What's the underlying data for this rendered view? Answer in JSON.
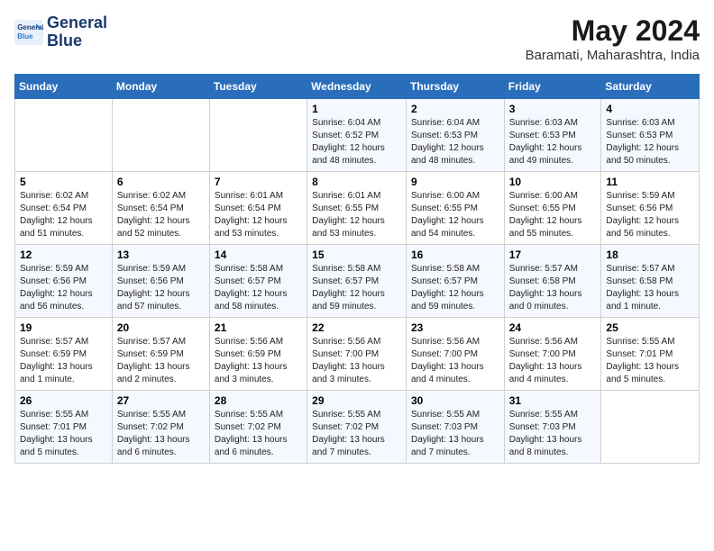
{
  "header": {
    "logo_line1": "General",
    "logo_line2": "Blue",
    "month_title": "May 2024",
    "location": "Baramati, Maharashtra, India"
  },
  "weekdays": [
    "Sunday",
    "Monday",
    "Tuesday",
    "Wednesday",
    "Thursday",
    "Friday",
    "Saturday"
  ],
  "weeks": [
    [
      {
        "day": "",
        "info": ""
      },
      {
        "day": "",
        "info": ""
      },
      {
        "day": "",
        "info": ""
      },
      {
        "day": "1",
        "info": "Sunrise: 6:04 AM\nSunset: 6:52 PM\nDaylight: 12 hours\nand 48 minutes."
      },
      {
        "day": "2",
        "info": "Sunrise: 6:04 AM\nSunset: 6:53 PM\nDaylight: 12 hours\nand 48 minutes."
      },
      {
        "day": "3",
        "info": "Sunrise: 6:03 AM\nSunset: 6:53 PM\nDaylight: 12 hours\nand 49 minutes."
      },
      {
        "day": "4",
        "info": "Sunrise: 6:03 AM\nSunset: 6:53 PM\nDaylight: 12 hours\nand 50 minutes."
      }
    ],
    [
      {
        "day": "5",
        "info": "Sunrise: 6:02 AM\nSunset: 6:54 PM\nDaylight: 12 hours\nand 51 minutes."
      },
      {
        "day": "6",
        "info": "Sunrise: 6:02 AM\nSunset: 6:54 PM\nDaylight: 12 hours\nand 52 minutes."
      },
      {
        "day": "7",
        "info": "Sunrise: 6:01 AM\nSunset: 6:54 PM\nDaylight: 12 hours\nand 53 minutes."
      },
      {
        "day": "8",
        "info": "Sunrise: 6:01 AM\nSunset: 6:55 PM\nDaylight: 12 hours\nand 53 minutes."
      },
      {
        "day": "9",
        "info": "Sunrise: 6:00 AM\nSunset: 6:55 PM\nDaylight: 12 hours\nand 54 minutes."
      },
      {
        "day": "10",
        "info": "Sunrise: 6:00 AM\nSunset: 6:55 PM\nDaylight: 12 hours\nand 55 minutes."
      },
      {
        "day": "11",
        "info": "Sunrise: 5:59 AM\nSunset: 6:56 PM\nDaylight: 12 hours\nand 56 minutes."
      }
    ],
    [
      {
        "day": "12",
        "info": "Sunrise: 5:59 AM\nSunset: 6:56 PM\nDaylight: 12 hours\nand 56 minutes."
      },
      {
        "day": "13",
        "info": "Sunrise: 5:59 AM\nSunset: 6:56 PM\nDaylight: 12 hours\nand 57 minutes."
      },
      {
        "day": "14",
        "info": "Sunrise: 5:58 AM\nSunset: 6:57 PM\nDaylight: 12 hours\nand 58 minutes."
      },
      {
        "day": "15",
        "info": "Sunrise: 5:58 AM\nSunset: 6:57 PM\nDaylight: 12 hours\nand 59 minutes."
      },
      {
        "day": "16",
        "info": "Sunrise: 5:58 AM\nSunset: 6:57 PM\nDaylight: 12 hours\nand 59 minutes."
      },
      {
        "day": "17",
        "info": "Sunrise: 5:57 AM\nSunset: 6:58 PM\nDaylight: 13 hours\nand 0 minutes."
      },
      {
        "day": "18",
        "info": "Sunrise: 5:57 AM\nSunset: 6:58 PM\nDaylight: 13 hours\nand 1 minute."
      }
    ],
    [
      {
        "day": "19",
        "info": "Sunrise: 5:57 AM\nSunset: 6:59 PM\nDaylight: 13 hours\nand 1 minute."
      },
      {
        "day": "20",
        "info": "Sunrise: 5:57 AM\nSunset: 6:59 PM\nDaylight: 13 hours\nand 2 minutes."
      },
      {
        "day": "21",
        "info": "Sunrise: 5:56 AM\nSunset: 6:59 PM\nDaylight: 13 hours\nand 3 minutes."
      },
      {
        "day": "22",
        "info": "Sunrise: 5:56 AM\nSunset: 7:00 PM\nDaylight: 13 hours\nand 3 minutes."
      },
      {
        "day": "23",
        "info": "Sunrise: 5:56 AM\nSunset: 7:00 PM\nDaylight: 13 hours\nand 4 minutes."
      },
      {
        "day": "24",
        "info": "Sunrise: 5:56 AM\nSunset: 7:00 PM\nDaylight: 13 hours\nand 4 minutes."
      },
      {
        "day": "25",
        "info": "Sunrise: 5:55 AM\nSunset: 7:01 PM\nDaylight: 13 hours\nand 5 minutes."
      }
    ],
    [
      {
        "day": "26",
        "info": "Sunrise: 5:55 AM\nSunset: 7:01 PM\nDaylight: 13 hours\nand 5 minutes."
      },
      {
        "day": "27",
        "info": "Sunrise: 5:55 AM\nSunset: 7:02 PM\nDaylight: 13 hours\nand 6 minutes."
      },
      {
        "day": "28",
        "info": "Sunrise: 5:55 AM\nSunset: 7:02 PM\nDaylight: 13 hours\nand 6 minutes."
      },
      {
        "day": "29",
        "info": "Sunrise: 5:55 AM\nSunset: 7:02 PM\nDaylight: 13 hours\nand 7 minutes."
      },
      {
        "day": "30",
        "info": "Sunrise: 5:55 AM\nSunset: 7:03 PM\nDaylight: 13 hours\nand 7 minutes."
      },
      {
        "day": "31",
        "info": "Sunrise: 5:55 AM\nSunset: 7:03 PM\nDaylight: 13 hours\nand 8 minutes."
      },
      {
        "day": "",
        "info": ""
      }
    ]
  ]
}
